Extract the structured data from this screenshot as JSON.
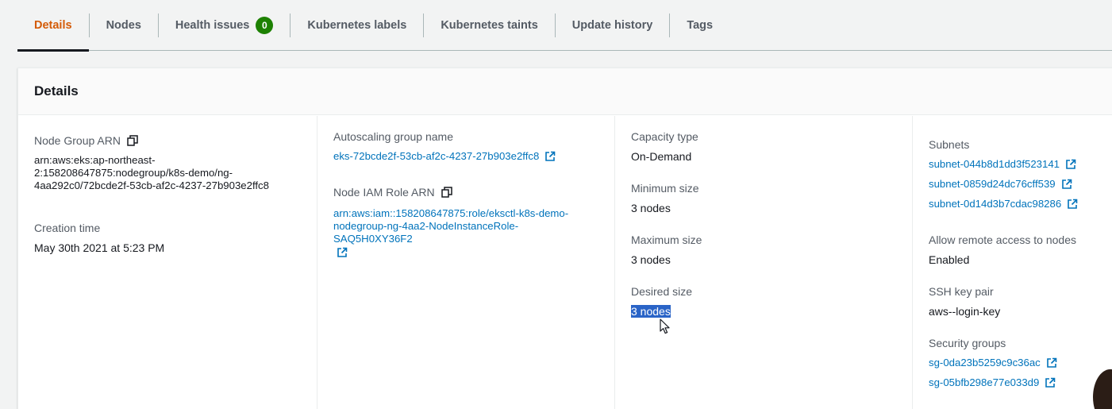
{
  "tabs": [
    {
      "label": "Details",
      "active": true
    },
    {
      "label": "Nodes"
    },
    {
      "label": "Health issues",
      "badge": "0"
    },
    {
      "label": "Kubernetes labels"
    },
    {
      "label": "Kubernetes taints"
    },
    {
      "label": "Update history"
    },
    {
      "label": "Tags"
    }
  ],
  "panel": {
    "title": "Details"
  },
  "col1": {
    "arn_label": "Node Group ARN",
    "arn_line1": "arn:aws:eks:ap-northeast-",
    "arn_line2": "2:158208647875:nodegroup/k8s-demo/ng-",
    "arn_line3": "4aa292c0/72bcde2f-53cb-af2c-4237-27b903e2ffc8",
    "creation_label": "Creation time",
    "creation_value": "May 30th 2021 at 5:23 PM"
  },
  "col2": {
    "asg_label": "Autoscaling group name",
    "asg_value": "eks-72bcde2f-53cb-af2c-4237-27b903e2ffc8",
    "role_label": "Node IAM Role ARN",
    "role_line1": "arn:aws:iam::158208647875:role/eksctl-k8s-demo-",
    "role_line2": "nodegroup-ng-4aa2-NodeInstanceRole-",
    "role_line3": "SAQ5H0XY36F2"
  },
  "col3": {
    "capacity_label": "Capacity type",
    "capacity_value": "On-Demand",
    "min_label": "Minimum size",
    "min_value": "3 nodes",
    "max_label": "Maximum size",
    "max_value": "3 nodes",
    "desired_label": "Desired size",
    "desired_value": "3 nodes"
  },
  "col4": {
    "subnets_label": "Subnets",
    "subnets": [
      "subnet-044b8d1dd3f523141",
      "subnet-0859d24dc76cff539",
      "subnet-0d14d3b7cdac98286"
    ],
    "remote_label": "Allow remote access to nodes",
    "remote_value": "Enabled",
    "ssh_label": "SSH key pair",
    "ssh_value": "aws--login-key",
    "sg_label": "Security groups",
    "security_groups": [
      "sg-0da23b5259c9c36ac",
      "sg-05bfb298e77e033d9"
    ]
  },
  "colors": {
    "accent_tab": "#d45b07",
    "link": "#0073bb",
    "badge": "#1d8102",
    "selection": "#2a64c7"
  },
  "icons": {
    "copy": "copy-icon",
    "external": "external-link-icon",
    "cursor": "mouse-pointer-icon"
  }
}
